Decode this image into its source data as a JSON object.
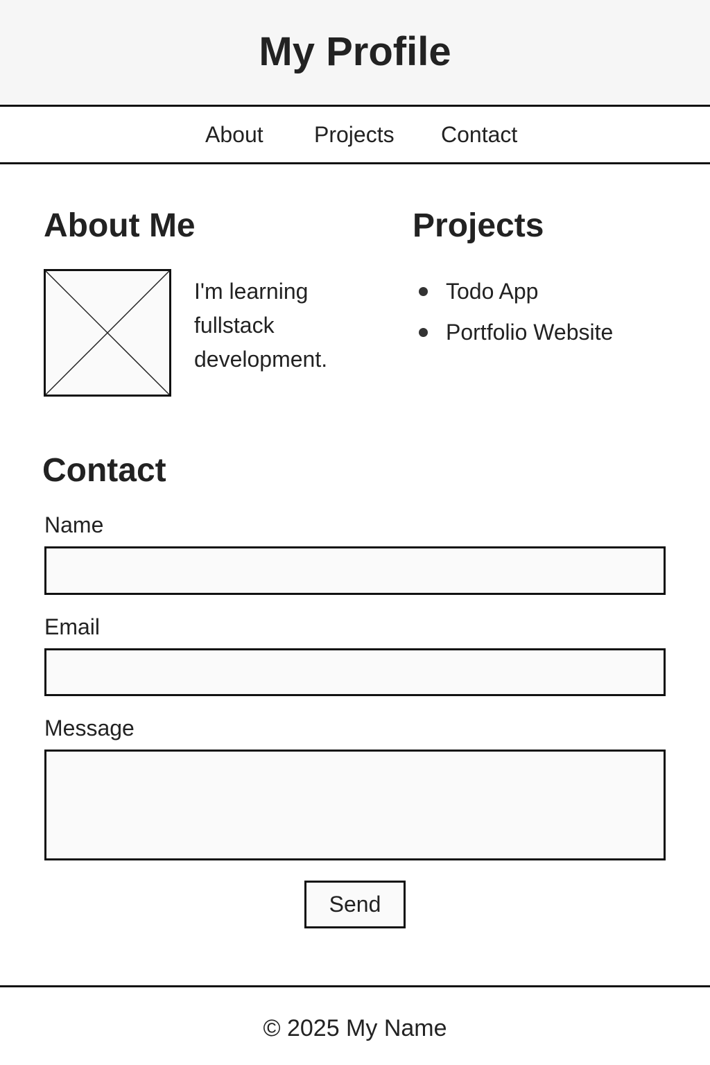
{
  "header": {
    "title": "My Profile"
  },
  "nav": {
    "items": [
      {
        "label": "About"
      },
      {
        "label": "Projects"
      },
      {
        "label": "Contact"
      }
    ]
  },
  "about": {
    "heading": "About Me",
    "text": "I'm learning fullstack development.",
    "image": "placeholder-image-icon"
  },
  "projects": {
    "heading": "Projects",
    "items": [
      {
        "label": "Todo App"
      },
      {
        "label": "Portfolio Website"
      }
    ]
  },
  "contact": {
    "heading": "Contact",
    "fields": {
      "name": {
        "label": "Name",
        "value": ""
      },
      "email": {
        "label": "Email",
        "value": ""
      },
      "message": {
        "label": "Message",
        "value": ""
      }
    },
    "send_label": "Send"
  },
  "footer": {
    "text": "© 2025 My Name"
  },
  "colors": {
    "border": "#111111",
    "text": "#222222",
    "header_background": "#f6f6f6",
    "input_background": "#fafafa"
  }
}
